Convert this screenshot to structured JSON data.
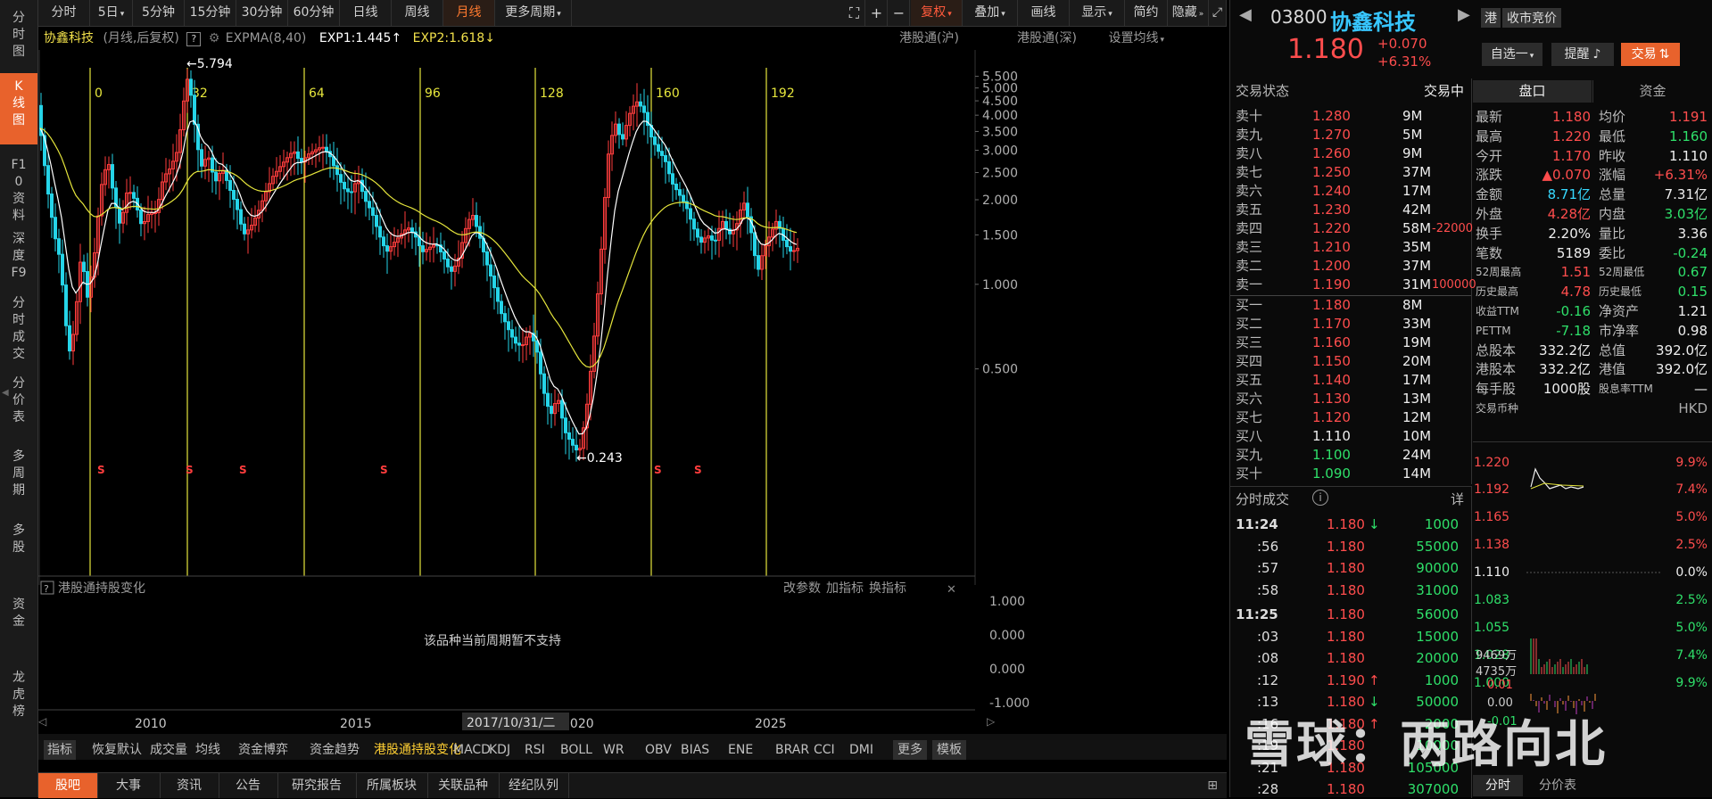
{
  "left_nav": [
    {
      "label": "分时图",
      "active": false
    },
    {
      "label": "K线图",
      "active": true
    },
    {
      "label": "F10资料",
      "active": false
    },
    {
      "label": "深度F9",
      "active": false
    },
    {
      "label": "分时成交",
      "active": false
    },
    {
      "label": "分价表",
      "active": false
    },
    {
      "label": "多周期",
      "active": false
    },
    {
      "label": "多股",
      "active": false
    },
    {
      "label": "资金",
      "active": false
    },
    {
      "label": "龙虎榜",
      "active": false
    }
  ],
  "toolbar": {
    "periods": [
      "分时",
      "5日",
      "5分钟",
      "15分钟",
      "30分钟",
      "60分钟",
      "日线",
      "周线",
      "月线",
      "更多周期"
    ],
    "active_period": "月线",
    "right": [
      "复权",
      "叠加",
      "画线",
      "显示",
      "简约",
      "隐藏"
    ]
  },
  "chart_info": {
    "stock": "协鑫科技",
    "mode": "(月线,后复权)",
    "indicator": "EXPMA(8,40)",
    "exp1": "EXP1:1.445",
    "exp2": "EXP2:1.618",
    "links": [
      "港股通(沪)",
      "港股通(深)",
      "设置均线"
    ]
  },
  "chart_annotations": {
    "high_label": "5.794",
    "low_label": "0.243",
    "cycle_labels": [
      "0",
      "32",
      "64",
      "96",
      "128",
      "160",
      "192"
    ],
    "s_marker": "S"
  },
  "chart_data": {
    "type": "candlestick",
    "scale": "log",
    "y_ticks": [
      "5.500",
      "5.000",
      "4.500",
      "4.000",
      "3.500",
      "3.000",
      "2.500",
      "2.000",
      "1.500",
      "1.000",
      "0.500"
    ],
    "x_labels": [
      "2010",
      "2015",
      "2020",
      "2025"
    ],
    "crosshair_date": "2017/10/31/二",
    "series": [
      {
        "name": "EXP1",
        "color": "#ffffff"
      },
      {
        "name": "EXP2",
        "color": "#e6e63c"
      }
    ]
  },
  "sub_panel": {
    "title": "港股通持股变化",
    "links": [
      "改参数",
      "加指标",
      "换指标"
    ],
    "message": "该品种当前周期暂不支持",
    "y_ticks": [
      "1.000",
      "0.000",
      "0.000",
      "-1.000"
    ]
  },
  "indicator_tabs": [
    "指标",
    "恢复默认",
    "成交量",
    "均线",
    "资金博弈",
    "资金趋势",
    "港股通持股变化",
    "MACD",
    "KDJ",
    "RSI",
    "BOLL",
    "WR",
    "OBV",
    "BIAS",
    "ENE",
    "BRAR",
    "CCI",
    "DMI",
    "更多",
    "模板"
  ],
  "active_indicator": "港股通持股变化",
  "bottom_tabs": [
    "股吧",
    "大事",
    "资讯",
    "公告",
    "研究报告",
    "所属板块",
    "关联品种",
    "经纪队列"
  ],
  "header": {
    "code": "03800",
    "name": "协鑫科技",
    "market": "港",
    "auction": "收市竞价",
    "price": "1.180",
    "change": "+0.070",
    "change_pct": "+6.31%",
    "watch": "自选一",
    "alert": "提醒",
    "trade": "交易"
  },
  "order_book": {
    "status_label": "交易状态",
    "status": "交易中",
    "sells": [
      {
        "label": "卖十",
        "price": "1.280",
        "vol": "9M",
        "extra": ""
      },
      {
        "label": "卖九",
        "price": "1.270",
        "vol": "5M",
        "extra": ""
      },
      {
        "label": "卖八",
        "price": "1.260",
        "vol": "9M",
        "extra": ""
      },
      {
        "label": "卖七",
        "price": "1.250",
        "vol": "37M",
        "extra": ""
      },
      {
        "label": "卖六",
        "price": "1.240",
        "vol": "17M",
        "extra": ""
      },
      {
        "label": "卖五",
        "price": "1.230",
        "vol": "42M",
        "extra": ""
      },
      {
        "label": "卖四",
        "price": "1.220",
        "vol": "58M",
        "extra": "-22000"
      },
      {
        "label": "卖三",
        "price": "1.210",
        "vol": "35M",
        "extra": ""
      },
      {
        "label": "卖二",
        "price": "1.200",
        "vol": "37M",
        "extra": ""
      },
      {
        "label": "卖一",
        "price": "1.190",
        "vol": "31M",
        "extra": "100000"
      }
    ],
    "buys": [
      {
        "label": "买一",
        "price": "1.180",
        "vol": "8M"
      },
      {
        "label": "买二",
        "price": "1.170",
        "vol": "33M"
      },
      {
        "label": "买三",
        "price": "1.160",
        "vol": "19M"
      },
      {
        "label": "买四",
        "price": "1.150",
        "vol": "20M"
      },
      {
        "label": "买五",
        "price": "1.140",
        "vol": "17M"
      },
      {
        "label": "买六",
        "price": "1.130",
        "vol": "13M"
      },
      {
        "label": "买七",
        "price": "1.120",
        "vol": "12M"
      },
      {
        "label": "买八",
        "price": "1.110",
        "vol": "10M"
      },
      {
        "label": "买九",
        "price": "1.100",
        "vol": "24M"
      },
      {
        "label": "买十",
        "price": "1.090",
        "vol": "14M"
      }
    ]
  },
  "quote_tabs": [
    "盘口",
    "资金"
  ],
  "quote": [
    [
      "最新",
      "1.180",
      "均价",
      "1.191"
    ],
    [
      "最高",
      "1.220",
      "最低",
      "1.160"
    ],
    [
      "今开",
      "1.170",
      "昨收",
      "1.110"
    ],
    [
      "涨跌",
      "▲0.070",
      "涨幅",
      "+6.31%"
    ],
    [
      "金额",
      "8.71亿",
      "总量",
      "7.31亿"
    ],
    [
      "外盘",
      "4.28亿",
      "内盘",
      "3.03亿"
    ],
    [
      "换手",
      "2.20%",
      "量比",
      "3.36"
    ],
    [
      "笔数",
      "5189",
      "委比",
      "-0.24"
    ],
    [
      "52周最高",
      "1.51",
      "52周最低",
      "0.67"
    ],
    [
      "历史最高",
      "4.78",
      "历史最低",
      "0.15"
    ],
    [
      "收益TTM",
      "-0.16",
      "净资产",
      "1.21"
    ],
    [
      "PETTM",
      "-7.18",
      "市净率",
      "0.98"
    ],
    [
      "总股本",
      "332.2亿",
      "总值",
      "392.0亿"
    ],
    [
      "港股本",
      "332.2亿",
      "港值",
      "392.0亿"
    ],
    [
      "每手股",
      "1000股",
      "股息率TTM",
      "—"
    ],
    [
      "交易币种",
      "",
      "",
      "HKD"
    ]
  ],
  "ticks": {
    "title": "分时成交",
    "detail": "详",
    "rows": [
      {
        "time": "11:24",
        "price": "1.180",
        "arrow": "↓",
        "vol": "1000"
      },
      {
        "time": ":56",
        "price": "1.180",
        "arrow": "",
        "vol": "55000"
      },
      {
        "time": ":57",
        "price": "1.180",
        "arrow": "",
        "vol": "90000"
      },
      {
        "time": ":58",
        "price": "1.180",
        "arrow": "",
        "vol": "31000"
      },
      {
        "time": "11:25",
        "price": "1.180",
        "arrow": "",
        "vol": "56000"
      },
      {
        "time": ":03",
        "price": "1.180",
        "arrow": "",
        "vol": "15000"
      },
      {
        "time": ":08",
        "price": "1.180",
        "arrow": "",
        "vol": "20000"
      },
      {
        "time": ":12",
        "price": "1.190",
        "arrow": "↑",
        "vol": "1000"
      },
      {
        "time": ":13",
        "price": "1.180",
        "arrow": "↓",
        "vol": "50000"
      },
      {
        "time": ":16",
        "price": "1.180",
        "arrow": "↑",
        "vol": "2000"
      },
      {
        "time": ":19",
        "price": "1.180",
        "arrow": "",
        "vol": "10000"
      },
      {
        "time": ":21",
        "price": "1.180",
        "arrow": "",
        "vol": "105000"
      },
      {
        "time": ":28",
        "price": "1.180",
        "arrow": "",
        "vol": "307000"
      }
    ]
  },
  "mini_chart": {
    "left_ticks": [
      "1.220",
      "1.192",
      "1.165",
      "1.138",
      "1.110",
      "1.083",
      "1.055",
      "1.028",
      "1.000"
    ],
    "right_ticks": [
      "9.9%",
      "7.4%",
      "5.0%",
      "2.5%",
      "0.0%",
      "2.5%",
      "5.0%",
      "7.4%",
      "9.9%"
    ],
    "vol_ticks": [
      "9469万",
      "4735万",
      "0.01",
      "0.00",
      "-0.01"
    ]
  },
  "mini_tabs": [
    "分时",
    "分价表"
  ],
  "watermark": "雪球：两路向北"
}
